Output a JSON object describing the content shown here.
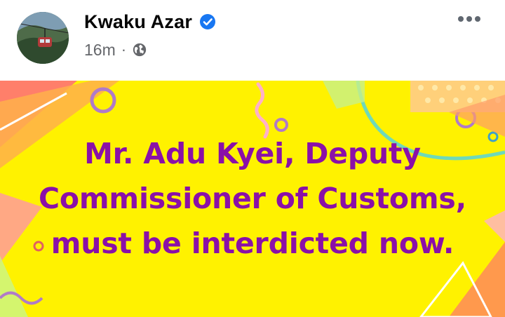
{
  "post": {
    "author_name": "Kwaku Azar",
    "timestamp": "16m",
    "separator": "·",
    "audience_icon": "globe-icon",
    "verified_icon": "verified-badge-icon",
    "more_icon": "more-options-icon",
    "text": "Mr. Adu Kyei, Deputy Commissioner of Customs, must be interdicted now.",
    "background_color": "#fff200",
    "text_color": "#8a10a8"
  }
}
